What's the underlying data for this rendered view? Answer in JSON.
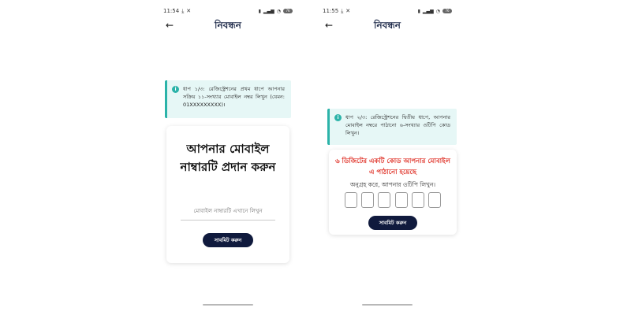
{
  "colors": {
    "accent": "#2bb3a9",
    "info_bg": "#e6f7f6",
    "button_bg": "#101a3d",
    "title": "#1e2a4a",
    "error_red": "#e0372d"
  },
  "screen1": {
    "status": {
      "time": "11:54",
      "battery": "76"
    },
    "title": "নিবন্ধন",
    "info": "ধাপ ১/৩: রেজিস্ট্রেশনের প্রথম ধাপে আপনার সক্রিয় ১১-সংখ্যার মোবাইল নম্বর লিখুন (যেমন: 01XXXXXXXXX)।",
    "card_title": "আপনার মোবাইল নাম্বারটি প্রদান করুন",
    "input_placeholder": "মোবাইল নাম্বারটি এখানে লিখুন",
    "submit_label": "সাবমিট করুন"
  },
  "screen2": {
    "status": {
      "time": "11:55",
      "battery": "76"
    },
    "title": "নিবন্ধন",
    "info": "ধাপ ২/৩: রেজিস্ট্রেশনের দ্বিতীয় ধাপে, আপনার মোবাইল নম্বরে পাঠানো ৬-সংখ্যার ওটিপি কোড লিখুন।",
    "otp_heading": "৬ ডিজিটের একটি কোড আপনার মোবাইল এ পাঠানো হয়েছে",
    "otp_prompt": "অনুগ্রহ করে, আপনার ওটিপি লিখুন।",
    "submit_label": "সাবমিট করুন"
  }
}
